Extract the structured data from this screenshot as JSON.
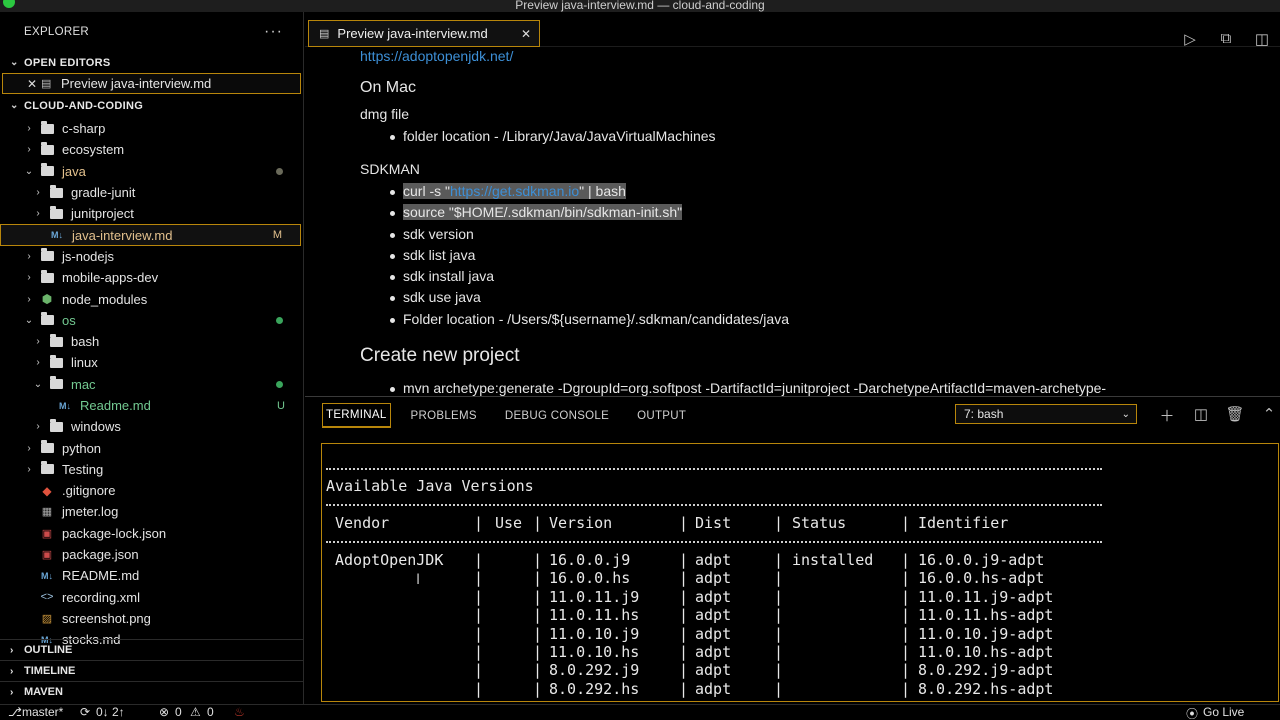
{
  "window": {
    "title": "Preview java-interview.md — cloud-and-coding"
  },
  "sidebar": {
    "header": "EXPLORER",
    "more": "···",
    "open_editors": {
      "label": "OPEN EDITORS",
      "items": [
        {
          "label": "Preview java-interview.md"
        }
      ]
    },
    "workspace": {
      "label": "CLOUD-AND-CODING"
    },
    "tree": [
      {
        "label": "c-sharp",
        "type": "folder",
        "depth": 0,
        "expanded": false
      },
      {
        "label": "ecosystem",
        "type": "folder",
        "depth": 0,
        "expanded": false
      },
      {
        "label": "java",
        "type": "folder",
        "depth": 0,
        "expanded": true,
        "status": "dot-dim",
        "color": "mod"
      },
      {
        "label": "gradle-junit",
        "type": "folder",
        "depth": 1,
        "expanded": false
      },
      {
        "label": "junitproject",
        "type": "folder",
        "depth": 1,
        "expanded": false
      },
      {
        "label": "java-interview.md",
        "type": "md",
        "depth": 1,
        "selected": true,
        "badge": "M",
        "color": "mod"
      },
      {
        "label": "js-nodejs",
        "type": "folder",
        "depth": 0,
        "expanded": false
      },
      {
        "label": "mobile-apps-dev",
        "type": "folder",
        "depth": 0,
        "expanded": false
      },
      {
        "label": "node_modules",
        "type": "nodemodules",
        "depth": 0,
        "expanded": false
      },
      {
        "label": "os",
        "type": "folder",
        "depth": 0,
        "expanded": true,
        "status": "dot-green",
        "color": "green"
      },
      {
        "label": "bash",
        "type": "folder",
        "depth": 1,
        "expanded": false
      },
      {
        "label": "linux",
        "type": "folder",
        "depth": 1,
        "expanded": false
      },
      {
        "label": "mac",
        "type": "folder",
        "depth": 1,
        "expanded": true,
        "status": "dot-green",
        "color": "green"
      },
      {
        "label": "Readme.md",
        "type": "md",
        "depth": 2,
        "badge": "U",
        "color": "green"
      },
      {
        "label": "windows",
        "type": "folder",
        "depth": 1,
        "expanded": false
      },
      {
        "label": "python",
        "type": "folder",
        "depth": 0,
        "expanded": false
      },
      {
        "label": "Testing",
        "type": "folder",
        "depth": 0,
        "expanded": false
      },
      {
        "label": ".gitignore",
        "type": "git",
        "depth": 0
      },
      {
        "label": "jmeter.log",
        "type": "log",
        "depth": 0
      },
      {
        "label": "package-lock.json",
        "type": "json",
        "depth": 0
      },
      {
        "label": "package.json",
        "type": "json",
        "depth": 0
      },
      {
        "label": "README.md",
        "type": "md",
        "depth": 0
      },
      {
        "label": "recording.xml",
        "type": "xml",
        "depth": 0
      },
      {
        "label": "screenshot.png",
        "type": "png",
        "depth": 0
      },
      {
        "label": "stocks.md",
        "type": "md",
        "depth": 0
      }
    ],
    "bottom_sections": [
      "OUTLINE",
      "TIMELINE",
      "MAVEN"
    ]
  },
  "editor": {
    "tab_label": "Preview java-interview.md",
    "preview": {
      "link": "https://adoptopenjdk.net/",
      "heading_mac": "On Mac",
      "dmg_label": "dmg file",
      "dmg_items": [
        "folder location - /Library/Java/JavaVirtualMachines"
      ],
      "sdkman_label": "SDKMAN",
      "sdk_item1_pre": "curl -s \"",
      "sdk_item1_link": "https://get.sdkman.io",
      "sdk_item1_post": "\" | bash",
      "sdk_item2": "source \"$HOME/.sdkman/bin/sdkman-init.sh\"",
      "sdk_items": [
        "sdk version",
        "sdk list java",
        "sdk install java",
        "sdk use java",
        "Folder location - /Users/${username}/.sdkman/candidates/java"
      ],
      "heading_project": "Create new project",
      "project_items": [
        "mvn archetype:generate -DgroupId=org.softpost -DartifactId=junitproject -DarchetypeArtifactId=maven-archetype-"
      ]
    }
  },
  "panel": {
    "tabs": [
      "TERMINAL",
      "PROBLEMS",
      "DEBUG CONSOLE",
      "OUTPUT"
    ],
    "active_tab": "TERMINAL",
    "terminal_select": "7: bash",
    "terminal": {
      "title": "Available Java Versions",
      "headers": [
        "Vendor",
        "Use",
        "Version",
        "Dist",
        "Status",
        "Identifier"
      ],
      "rows": [
        {
          "vendor": "AdoptOpenJDK",
          "use": "",
          "version": "16.0.0.j9",
          "dist": "adpt",
          "status": "installed",
          "identifier": "16.0.0.j9-adpt"
        },
        {
          "vendor": "",
          "use": "",
          "version": "16.0.0.hs",
          "dist": "adpt",
          "status": "",
          "identifier": "16.0.0.hs-adpt"
        },
        {
          "vendor": "",
          "use": "",
          "version": "11.0.11.j9",
          "dist": "adpt",
          "status": "",
          "identifier": "11.0.11.j9-adpt"
        },
        {
          "vendor": "",
          "use": "",
          "version": "11.0.11.hs",
          "dist": "adpt",
          "status": "",
          "identifier": "11.0.11.hs-adpt"
        },
        {
          "vendor": "",
          "use": "",
          "version": "11.0.10.j9",
          "dist": "adpt",
          "status": "",
          "identifier": "11.0.10.j9-adpt"
        },
        {
          "vendor": "",
          "use": "",
          "version": "11.0.10.hs",
          "dist": "adpt",
          "status": "",
          "identifier": "11.0.10.hs-adpt"
        },
        {
          "vendor": "",
          "use": "",
          "version": "8.0.292.j9",
          "dist": "adpt",
          "status": "",
          "identifier": "8.0.292.j9-adpt"
        },
        {
          "vendor": "",
          "use": "",
          "version": "8.0.292.hs",
          "dist": "adpt",
          "status": "",
          "identifier": "8.0.292.hs-adpt"
        }
      ]
    }
  },
  "statusbar": {
    "branch": "master*",
    "sync": "0↓ 2↑",
    "problems": "0",
    "warnings": "0",
    "golive": "Go Live"
  },
  "colors": {
    "accent_border": "#b8860b",
    "link": "#3d8fd6",
    "modified": "#e2c08d",
    "untracked": "#73c991"
  }
}
